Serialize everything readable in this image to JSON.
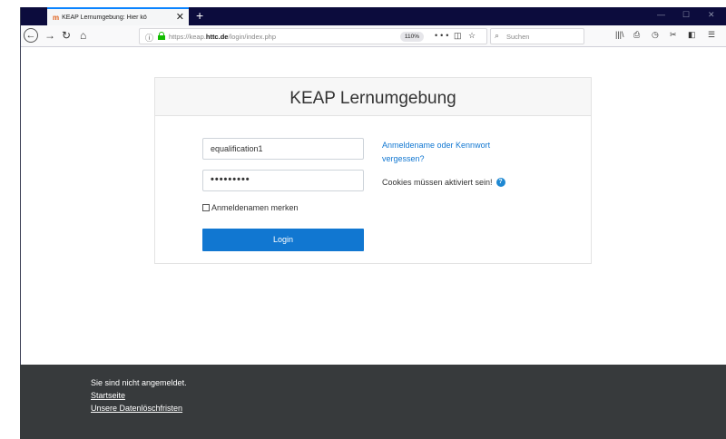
{
  "browser": {
    "tab_title": "KEAP Lernumgebung: Hier kö",
    "tab_favicon": "moodle-icon",
    "url_prefix": "https://keap.",
    "url_domain": "httc.de",
    "url_path": "/login/index.php",
    "zoom": "110%",
    "search_placeholder": "Suchen",
    "accent_color": "#0a84ff"
  },
  "login": {
    "title": "KEAP Lernumgebung",
    "username_value": "equalification1",
    "password_mask": "•••••••••",
    "remember_label": "Anmeldenamen merken",
    "remember_checked": false,
    "submit_label": "Login",
    "forgot_link": "Anmeldename oder Kennwort vergessen?",
    "cookies_notice": "Cookies müssen aktiviert sein!",
    "button_color": "#1177d1"
  },
  "footer": {
    "status": "Sie sind nicht angemeldet.",
    "links": [
      "Startseite",
      "Unsere Datenlöschfristen"
    ],
    "background": "#373a3c"
  }
}
